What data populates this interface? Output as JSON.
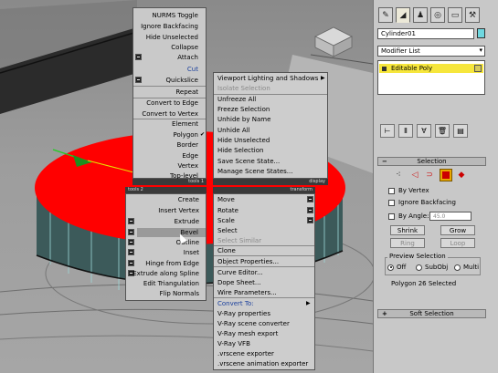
{
  "quad_menu": {
    "left_top": {
      "items": [
        "NURMS Toggle",
        "Ignore Backfacing",
        "Hide Unselected",
        "Collapse",
        "Attach",
        "Cut",
        "Quickslice",
        "Repeat",
        "Convert to Edge",
        "Convert to Vertex",
        "Element",
        "Polygon",
        "Border",
        "Edge",
        "Vertex",
        "Top-level"
      ],
      "label": "tools 1"
    },
    "right_top": {
      "items": [
        "Viewport Lighting and Shadows",
        "Isolate Selection",
        "Unfreeze All",
        "Freeze Selection",
        "Unhide by Name",
        "Unhide All",
        "Hide Unselected",
        "Hide Selection",
        "Save Scene State...",
        "Manage Scene States..."
      ],
      "label": "display"
    },
    "left_bottom": {
      "items": [
        "Create",
        "Insert Vertex",
        "Extrude",
        "Bevel",
        "Outline",
        "Inset",
        "Hinge from Edge",
        "Extrude along Spline",
        "Edit Triangulation",
        "Flip Normals"
      ],
      "label": "tools 2"
    },
    "right_bottom": {
      "items": [
        "Move",
        "Rotate",
        "Scale",
        "Select",
        "Select Similar",
        "Clone",
        "Object Properties...",
        "Curve Editor...",
        "Dope Sheet...",
        "Wire Parameters...",
        "Convert To:",
        "V-Ray properties",
        "V-Ray scene converter",
        "V-Ray mesh export",
        "V-Ray VFB",
        ".vrscene exporter",
        ".vrscene animation exporter"
      ],
      "label": "transform"
    }
  },
  "panel": {
    "tabs": [
      "create-icon",
      "modify-icon",
      "hierarchy-icon",
      "motion-icon",
      "display-icon",
      "utilities-icon"
    ],
    "object_name": "Cylinder01",
    "object_color": "#6fd8e0",
    "modifier_list": "Modifier List",
    "stack_item": "Editable Poly",
    "selection_rollout": "Selection",
    "by_vertex": "By Vertex",
    "ignore_backfacing": "Ignore Backfacing",
    "by_angle": "By Angle:",
    "by_angle_value": "45.0",
    "shrink": "Shrink",
    "grow": "Grow",
    "ring": "Ring",
    "loop": "Loop",
    "preview_selection": "Preview Selection",
    "preview_off": "Off",
    "preview_subobj": "SubObj",
    "preview_multi": "Multi",
    "status": "Polygon 26 Selected",
    "soft_selection": "Soft Selection"
  },
  "colors": {
    "selected_polygon": "#ff0000",
    "stack_highlight": "#f6e63c",
    "active_subobject": "#e8a800"
  }
}
